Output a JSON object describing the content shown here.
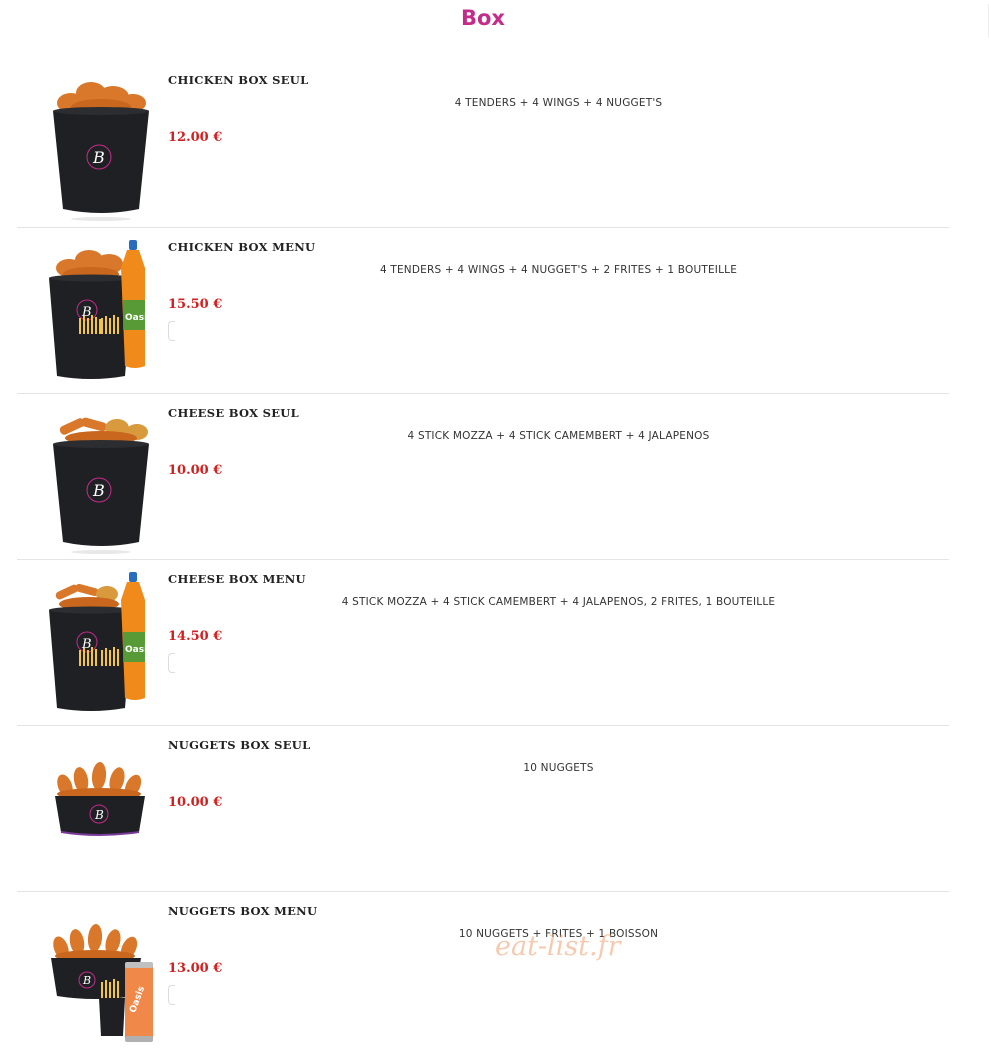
{
  "page": {
    "title": "Box",
    "watermark": "eat-list.fr"
  },
  "colors": {
    "title": "#c42c8a",
    "price": "#d12020",
    "watermark": "#f0a070",
    "bucket": "#1f2024",
    "chicken": "#d9782a",
    "juice": "#f08a1a",
    "fries": "#f3c542"
  },
  "items": [
    {
      "name": "CHICKEN BOX SEUL",
      "desc": "4 TENDERS + 4 WINGS + 4 NUGGET'S",
      "price": "12.00 €",
      "image": "chicken-bucket"
    },
    {
      "name": "CHICKEN BOX MENU",
      "desc": "4 TENDERS + 4 WINGS + 4 NUGGET'S + 2 FRITES + 1 BOUTEILLE",
      "price": "15.50 €",
      "image": "chicken-bucket-menu"
    },
    {
      "name": "CHEESE BOX SEUL",
      "desc": "4 STICK MOZZA + 4 STICK CAMEMBERT + 4 JALAPENOS",
      "price": "10.00 €",
      "image": "cheese-bucket"
    },
    {
      "name": "CHEESE BOX MENU",
      "desc": "4 STICK MOZZA + 4 STICK CAMEMBERT + 4 JALAPENOS, 2 FRITES, 1 BOUTEILLE",
      "price": "14.50 €",
      "image": "cheese-bucket-menu"
    },
    {
      "name": "NUGGETS BOX SEUL",
      "desc": "10 NUGGETS",
      "price": "10.00 €",
      "image": "nuggets-bowl"
    },
    {
      "name": "NUGGETS BOX MENU",
      "desc": "10 NUGGETS + FRITES + 1 BOISSON",
      "price": "13.00 €",
      "image": "nuggets-bowl-menu"
    }
  ]
}
